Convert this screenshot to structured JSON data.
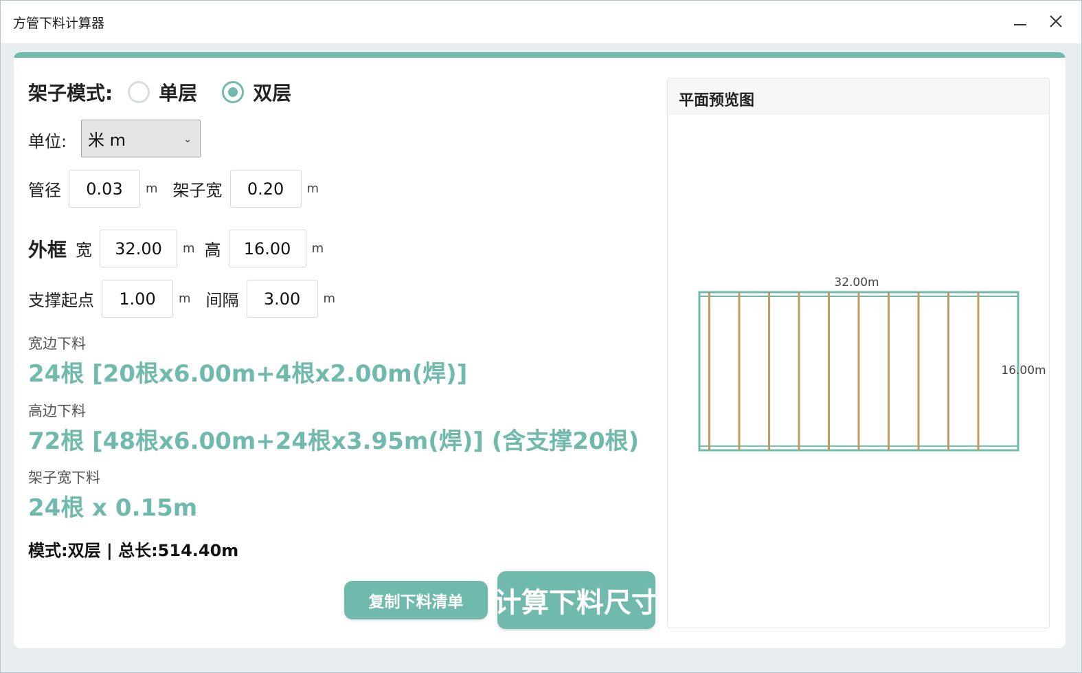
{
  "window": {
    "title": "方管下料计算器",
    "minimize_icon": "minimize-icon",
    "close_icon": "close-icon"
  },
  "colors": {
    "accent": "#6fb9ad",
    "support_bar": "#c49a5e",
    "frame": "#6fb9ad"
  },
  "mode": {
    "label": "架子模式:",
    "options": [
      {
        "label": "单层",
        "selected": false
      },
      {
        "label": "双层",
        "selected": true
      }
    ]
  },
  "unit": {
    "label": "单位:",
    "selected": "米 m"
  },
  "pipe": {
    "diameter_label": "管径",
    "diameter_value": "0.03",
    "diameter_unit": "m",
    "shelf_width_label": "架子宽",
    "shelf_width_value": "0.20",
    "shelf_width_unit": "m"
  },
  "outer_frame": {
    "label": "外框",
    "width_label": "宽",
    "width_value": "32.00",
    "width_unit": "m",
    "height_label": "高",
    "height_value": "16.00",
    "height_unit": "m"
  },
  "support": {
    "start_label": "支撑起点",
    "start_value": "1.00",
    "start_unit": "m",
    "interval_label": "间隔",
    "interval_value": "3.00",
    "interval_unit": "m"
  },
  "results": {
    "width_cut_label": "宽边下料",
    "width_cut_value": "24根 [20根x6.00m+4根x2.00m(焊)]",
    "height_cut_label": "高边下料",
    "height_cut_value": "72根 [48根x6.00m+24根x3.95m(焊)] (含支撑20根)",
    "shelf_cut_label": "架子宽下料",
    "shelf_cut_value": "24根 x 0.15m",
    "summary": "模式:双层 | 总长:514.40m"
  },
  "buttons": {
    "copy": "复制下料清单",
    "calculate": "计算下料尺寸"
  },
  "preview": {
    "title": "平面预览图",
    "width_label": "32.00m",
    "height_label": "16.00m",
    "frame_width": 32,
    "frame_height": 16,
    "support_start": 1,
    "support_interval": 3,
    "support_count": 10
  }
}
